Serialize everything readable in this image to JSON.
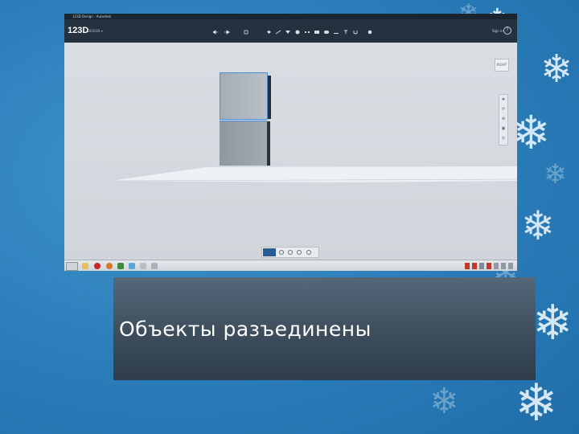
{
  "slide": {
    "caption": "Объекты разъединены",
    "accent_color": "#2a7cb8",
    "caption_bg": "#3d4d5c"
  },
  "app": {
    "logo_text": "123D",
    "logo_sub": "DESIGN ▾",
    "window_title": "123D Design - Autodesk",
    "signin_label": "Sign in",
    "help_label": "?",
    "viewcube_label": "RIGHT"
  },
  "toolbar": {
    "tools": [
      "undo-icon",
      "redo-icon",
      "transform-icon",
      "primitives-icon",
      "sketch-icon",
      "construct-icon",
      "modify-icon",
      "pattern-icon",
      "grouping-icon",
      "combine-icon",
      "measure-icon",
      "text-icon",
      "snap-icon",
      "material-icon"
    ]
  },
  "navbar": {
    "buttons": [
      "pan-icon",
      "orbit-icon",
      "zoom-icon",
      "fit-icon",
      "view-icon"
    ]
  },
  "bottombar": {
    "buttons": [
      "select-mode-icon",
      "show-solids-icon",
      "show-sketches-icon",
      "show-meshes-icon",
      "grid-icon"
    ]
  }
}
